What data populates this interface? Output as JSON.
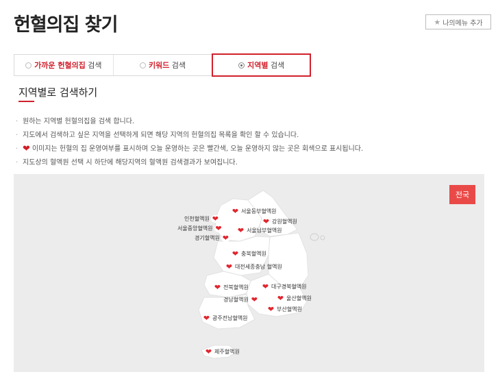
{
  "page": {
    "title": "헌혈의집 찾기",
    "mymenu_label": "나의메뉴 추가"
  },
  "tabs": [
    {
      "highlight": "가까운 헌혈의집",
      "suffix": " 검색",
      "active": false
    },
    {
      "highlight": "키워드",
      "suffix": " 검색",
      "active": false
    },
    {
      "highlight": "지역별",
      "suffix": " 검색",
      "active": true
    }
  ],
  "section": {
    "title": "지역별로 검색하기"
  },
  "descriptions": [
    "원하는 지역별 헌혈의집을 검색 합니다.",
    "지도에서 검색하고 싶은 지역을 선택하게 되면 해당 지역의 헌혈의집 목록을 확인 할 수 있습니다.",
    "이미지는 헌혈의 집 운영여부를 표시하며 오늘 운영하는 곳은 빨간색, 오늘 운영하지 않는 곳은 회색으로 표시됩니다.",
    "지도상의 혈액원 선택 시 하단에 해당지역의 혈액원 검색결과가 보여집니다."
  ],
  "map": {
    "nationwide_label": "전국",
    "centers": [
      {
        "name": "서울동부혈액원"
      },
      {
        "name": "인천혈액원"
      },
      {
        "name": "강원혈액원"
      },
      {
        "name": "서울중앙혈액원"
      },
      {
        "name": "서울남부혈액원"
      },
      {
        "name": "경기혈액원"
      },
      {
        "name": "충북혈액원"
      },
      {
        "name": "대전세종충남 혈액원"
      },
      {
        "name": "전북혈액원"
      },
      {
        "name": "대구경북혈액원"
      },
      {
        "name": "경남혈액원"
      },
      {
        "name": "울산혈액원"
      },
      {
        "name": "부산혈액원"
      },
      {
        "name": "광주전남혈액원"
      },
      {
        "name": "제주혈액원"
      }
    ]
  },
  "colors": {
    "accent": "#d11f2b",
    "nationwide_bg": "#e94a48",
    "map_bg": "#ececec"
  },
  "icons": {
    "mymenu": "star-icon",
    "center": "heart-icon"
  }
}
